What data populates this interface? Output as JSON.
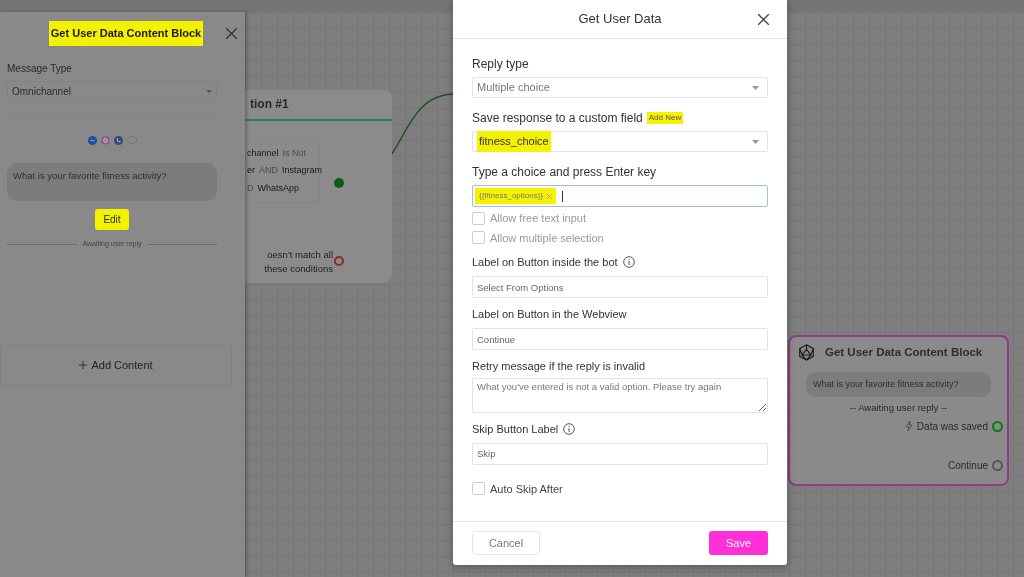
{
  "side_panel": {
    "title": "Get User Data Content Block",
    "title_highlighted": true,
    "message_type_label": "Message Type",
    "message_type": "Omnichannel",
    "message": "What is your favorite fitness activity?",
    "edit_button": "Edit",
    "edit_highlighted": true,
    "awaiting": "Awaiting user reply",
    "add_content": "Add Content"
  },
  "condition_node": {
    "title": "tion #1",
    "lines": [
      [
        {
          "text": "channel",
          "kind": "value"
        },
        {
          "text": "Is Not",
          "kind": "operator"
        }
      ],
      [
        {
          "text": "er",
          "kind": "value"
        },
        {
          "text": "AND",
          "kind": "operator"
        },
        {
          "text": "Instagram",
          "kind": "value"
        }
      ],
      [
        {
          "text": "D",
          "kind": "operator"
        },
        {
          "text": "WhatsApp",
          "kind": "value"
        }
      ]
    ],
    "else_text": "oesn't match all these conditions"
  },
  "modal": {
    "title": "Get User Data",
    "fields": [
      {
        "kind": "select",
        "label": "Reply type",
        "value": "Multiple choice",
        "highlighted": false
      },
      {
        "kind": "select",
        "label": "Save response to a custom field",
        "link": "Add New",
        "value": "fitness_choice",
        "highlighted": true
      },
      {
        "kind": "tags",
        "label": "Type a choice and press Enter key",
        "tags": [
          {
            "text": "{{fitness_options}}",
            "highlighted": true
          }
        ]
      },
      {
        "kind": "checkbox",
        "label": "Allow free text input",
        "checked": false,
        "disabled": true
      },
      {
        "kind": "checkbox",
        "label": "Allow multiple selection",
        "checked": false,
        "disabled": true
      },
      {
        "kind": "input_info",
        "label": "Label on Button inside the bot",
        "placeholder": "Select From Options"
      },
      {
        "kind": "input",
        "label": "Label on Button in the Webview",
        "placeholder": "Continue"
      },
      {
        "kind": "textarea",
        "label": "Retry message if the reply is invalid",
        "placeholder": "What you've entered is not a valid option. Please try again"
      },
      {
        "kind": "input_info",
        "label": "Skip Button Label",
        "placeholder": "Skip"
      },
      {
        "kind": "checkbox",
        "label": "Auto Skip After",
        "checked": false,
        "disabled": false
      }
    ],
    "cancel": "Cancel",
    "save": "Save"
  },
  "data_node": {
    "title": "Get User Data Content Block",
    "message": "What is your favorite fitness activity?",
    "awaiting": "-- Awaiting user reply --",
    "outputs": [
      {
        "label": "Data was saved",
        "kind": "saved",
        "color": "#0f7a0f"
      },
      {
        "label": "Continue",
        "kind": "plain",
        "color": "#555555"
      }
    ]
  }
}
